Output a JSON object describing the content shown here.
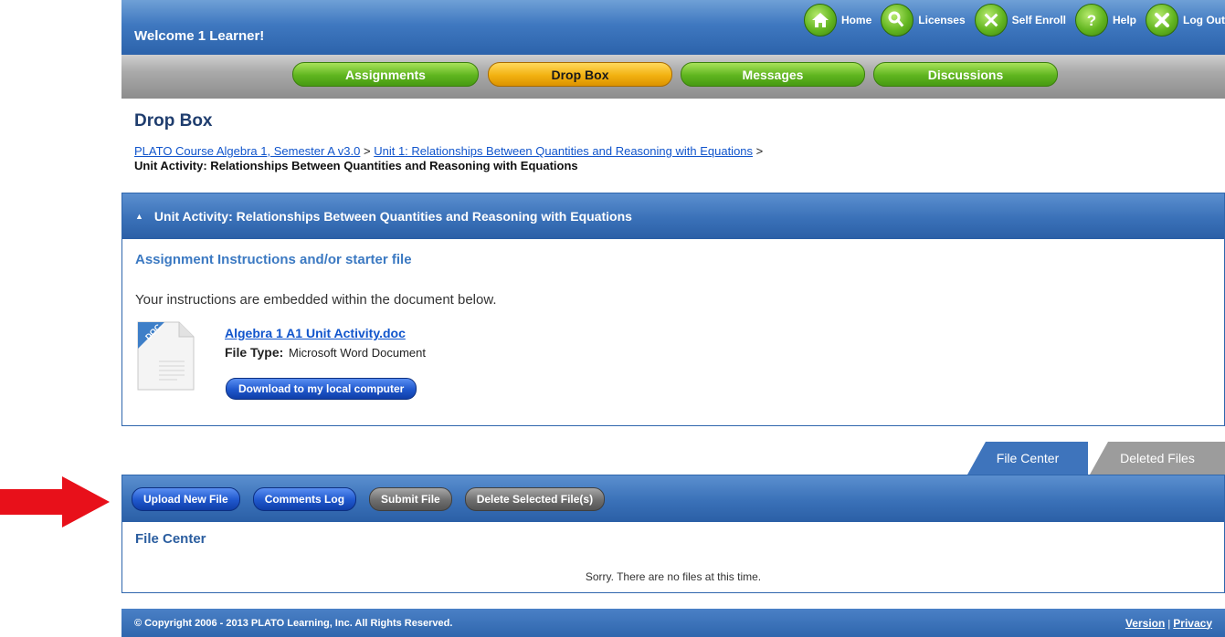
{
  "header": {
    "welcome": "Welcome 1 Learner!",
    "nav": [
      {
        "label": "Home",
        "icon": "home-icon"
      },
      {
        "label": "Licenses",
        "icon": "key-icon"
      },
      {
        "label": "Self Enroll",
        "icon": "tools-icon"
      },
      {
        "label": "Help",
        "icon": "help-icon"
      },
      {
        "label": "Log Out",
        "icon": "close-icon"
      }
    ]
  },
  "tabs": [
    {
      "label": "Assignments",
      "active": false
    },
    {
      "label": "Drop Box",
      "active": true
    },
    {
      "label": "Messages",
      "active": false
    },
    {
      "label": "Discussions",
      "active": false
    }
  ],
  "page": {
    "title": "Drop Box",
    "breadcrumb": {
      "course": "PLATO Course Algebra 1, Semester A v3.0",
      "unit": "Unit 1: Relationships Between Quantities and Reasoning with Equations",
      "sep": ">",
      "current": "Unit Activity: Relationships Between Quantities and Reasoning with Equations"
    }
  },
  "activity_panel": {
    "heading": "Unit Activity: Relationships Between Quantities and Reasoning with Equations",
    "subheading": "Assignment Instructions and/or starter file",
    "instructions": "Your instructions are embedded within the document below.",
    "file": {
      "name": "Algebra 1 A1 Unit Activity.doc",
      "type_label": "File Type:",
      "type_value": "Microsoft Word Document",
      "icon_text": "DOC"
    },
    "download_label": "Download to my local computer"
  },
  "file_tabs": {
    "file_center": "File Center",
    "deleted_files": "Deleted Files"
  },
  "file_center": {
    "buttons": {
      "upload": "Upload New File",
      "comments": "Comments Log",
      "submit": "Submit File",
      "delete": "Delete Selected File(s)"
    },
    "title": "File Center",
    "empty_message": "Sorry. There are no files at this time."
  },
  "footer": {
    "copyright": "© Copyright 2006 - 2013 PLATO Learning, Inc. All Rights Reserved.",
    "version": "Version",
    "divider": "|",
    "privacy": "Privacy"
  },
  "colors": {
    "brand_blue": "#2f66ad",
    "nav_green": "#5fb51f",
    "active_tab": "#f2b111",
    "arrow_red": "#e8101a"
  }
}
